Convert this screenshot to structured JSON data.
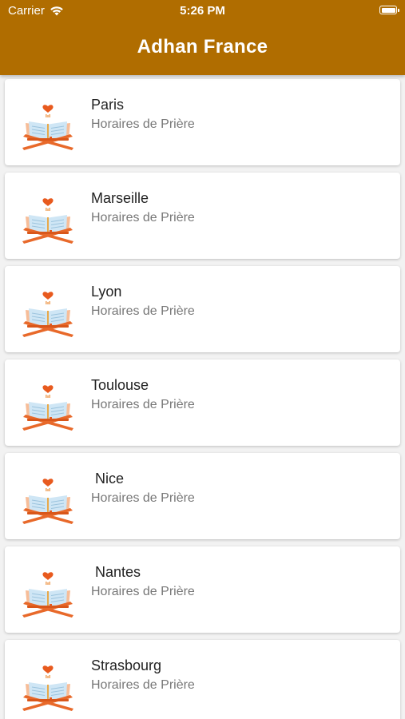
{
  "status_bar": {
    "carrier": "Carrier",
    "time": "5:26 PM"
  },
  "header": {
    "title": "Adhan France"
  },
  "colors": {
    "header_bg": "#b06d00",
    "icon_orange": "#e8692a",
    "icon_peach": "#f7bd98",
    "icon_page": "#cfe6f5",
    "icon_heart": "#e85a1e"
  },
  "cities": [
    {
      "name": "Paris",
      "subtitle": "Horaires de Prière",
      "icon": "quran-stand-icon"
    },
    {
      "name": "Marseille",
      "subtitle": "Horaires de Prière",
      "icon": "quran-stand-icon"
    },
    {
      "name": "Lyon",
      "subtitle": "Horaires de Prière",
      "icon": "quran-stand-icon"
    },
    {
      "name": "Toulouse",
      "subtitle": "Horaires de Prière",
      "icon": "quran-stand-icon"
    },
    {
      "name": " Nice",
      "subtitle": "Horaires de Prière",
      "icon": "quran-stand-icon"
    },
    {
      "name": " Nantes",
      "subtitle": "Horaires de Prière",
      "icon": "quran-stand-icon"
    },
    {
      "name": "Strasbourg",
      "subtitle": "Horaires de Prière",
      "icon": "quran-stand-icon"
    }
  ]
}
